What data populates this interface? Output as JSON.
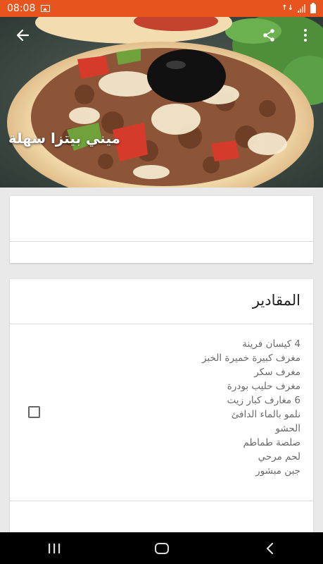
{
  "status_bar": {
    "time": "08:08",
    "data_icon_text": "↑↓",
    "icons": [
      "image-icon",
      "data-transfer-icon",
      "signal-icon",
      "battery-icon"
    ]
  },
  "hero": {
    "title": "ميني بيتزا سهلة",
    "icons": [
      "back-arrow-icon",
      "share-icon",
      "more-vert-icon"
    ]
  },
  "ingredients_card": {
    "title": "المقادير",
    "lines": [
      "4 كيسان فرينة",
      "مغرف كبيرة خميرة الخبز",
      "مغرف سكر",
      "مغرف حليب بودرة",
      "6 مغارف كبار زيت",
      "نلمو بالماء الدافئ",
      "الحشو",
      "صلصة طماطم",
      "لحم مرحي",
      "جبن مبشور"
    ],
    "checkbox_checked": false
  },
  "nav_bar": {
    "icons": [
      "recent-apps-icon",
      "home-icon",
      "back-icon"
    ]
  },
  "colors": {
    "status_bar": "#e8541e",
    "nav_bar": "#000000",
    "card": "#ffffff",
    "background": "#e9e9e9"
  }
}
